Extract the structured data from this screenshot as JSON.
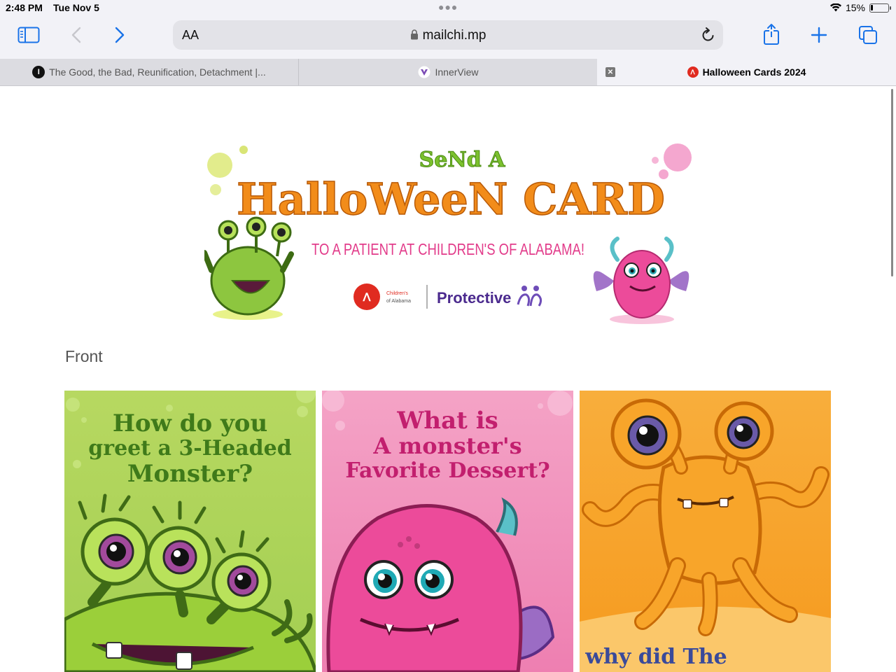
{
  "status_bar": {
    "time": "2:48 PM",
    "date": "Tue Nov 5",
    "battery_percent_label": "15%",
    "battery_level": 0.15
  },
  "toolbar": {
    "text_size_label": "AA",
    "url": "mailchi.mp",
    "icons": [
      "sidebar-icon",
      "back-icon",
      "forward-icon",
      "lock-icon",
      "reload-icon",
      "share-icon",
      "new-tab-icon",
      "tabs-overview-icon"
    ]
  },
  "tabs": [
    {
      "title": "The Good, the Bad, Reunification, Detachment |..."
    },
    {
      "title": "InnerView"
    },
    {
      "title": "Halloween Cards 2024",
      "active": true
    }
  ],
  "banner": {
    "line1": "SeNd A",
    "line2": "HalloWeeN CARD",
    "line3": "TO A PATIENT AT CHILDREN'S OF ALABAMA!",
    "logo_left_line1": "Children's",
    "logo_left_line2": "of Alabama",
    "logo_right": "Protective"
  },
  "content": {
    "section_label": "Front",
    "cards": [
      {
        "lines": [
          "How do you",
          "greet a 3-Headed",
          "Monster?"
        ],
        "color": "#a8d356"
      },
      {
        "lines": [
          "What is",
          "A monster's",
          "Favorite Dessert?"
        ],
        "color": "#f08ab8"
      },
      {
        "lines": [
          "why did The"
        ],
        "color": "#f7a32a"
      }
    ]
  },
  "colors": {
    "accent": "#1a73e8",
    "banner_orange": "#f28c1a",
    "banner_pink": "#e23b8a",
    "banner_green": "#7cc12e",
    "protective_purple": "#4b2a8e"
  }
}
